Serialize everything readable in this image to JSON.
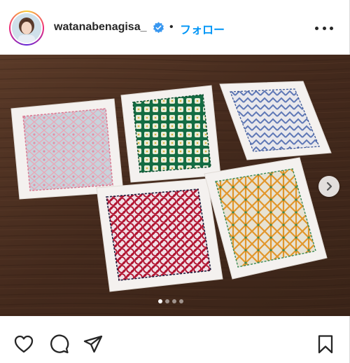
{
  "post": {
    "username": "watanabenagisa_",
    "verified": true,
    "separator": "•",
    "follow_label": "フォロー",
    "more_icon": "more-horizontal-icon",
    "carousel": {
      "total_slides": 4,
      "active_slide": 1,
      "next_icon": "chevron-right-icon"
    },
    "actions": {
      "like_icon": "heart-icon",
      "comment_icon": "comment-icon",
      "share_icon": "paper-plane-icon",
      "save_icon": "bookmark-icon"
    },
    "colors": {
      "follow_blue": "#0095f6",
      "verified_blue": "#3897f0",
      "text": "#262626",
      "table_wood": "#4a3022"
    }
  }
}
